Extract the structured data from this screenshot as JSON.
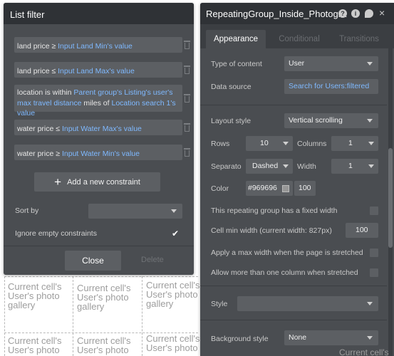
{
  "background": {
    "cells": [
      {
        "text": "Current cell's User's photo gallery"
      },
      {
        "text": "Current cell's User's photo gallery"
      },
      {
        "text": "Current cell's User's photo gallery"
      },
      {
        "text": "Current cell's User's photo"
      },
      {
        "text": "Current cell's User's photo"
      },
      {
        "text": "Current cell's User's photo"
      }
    ],
    "right_fragment": "Current cell's"
  },
  "list_filter": {
    "title": "List filter",
    "constraints": [
      {
        "prefix": "land price ≥",
        "dynamic": "Input Land Min's value"
      },
      {
        "prefix": "land price ≤",
        "dynamic": "Input Land Max's value"
      },
      {
        "prefix": "location is within",
        "dynamic": "Parent group's Listing's user's max travel distance",
        "middle": "miles of",
        "dynamic2": "Location search 1's value"
      },
      {
        "prefix": "water price ≤",
        "dynamic": "Input Water Max's value"
      },
      {
        "prefix": "water price ≥",
        "dynamic": "Input Water Min's value"
      }
    ],
    "add_constraint_label": "Add a new constraint",
    "sort_by_label": "Sort by",
    "sort_by_value": "",
    "ignore_empty_label": "Ignore empty constraints",
    "ignore_empty_checked": true,
    "close_label": "Close",
    "delete_label": "Delete"
  },
  "property_editor": {
    "title": "RepeatingGroup_Inside_Photogra",
    "tabs": [
      "Appearance",
      "Conditional",
      "Transitions"
    ],
    "active_tab": "Appearance",
    "type_of_content_label": "Type of content",
    "type_of_content_value": "User",
    "data_source_label": "Data source",
    "data_source_value": "Search for Users:filtered",
    "layout_style_label": "Layout style",
    "layout_style_value": "Vertical scrolling",
    "rows_label": "Rows",
    "rows_value": "10",
    "columns_label": "Columns",
    "columns_value": "1",
    "separator_label": "Separato",
    "separator_value": "Dashed",
    "width_label": "Width",
    "width_value": "1",
    "color_label": "Color",
    "color_hex": "#969696",
    "color_opacity": "100",
    "fixed_width_label": "This repeating group has a fixed width",
    "cell_min_width_label": "Cell min width (current width: 827px)",
    "cell_min_width_value": "100",
    "max_width_label": "Apply a max width when the page is stretched",
    "more_columns_label": "Allow more than one column when stretched",
    "style_label": "Style",
    "style_value": "",
    "bg_style_label": "Background style",
    "bg_style_value": "None"
  },
  "colors": {
    "panel_bg": "#4a4d51",
    "header_bg": "#2f3236",
    "field_bg": "#5c5f63",
    "dynamic_text": "#7fb9ff"
  }
}
